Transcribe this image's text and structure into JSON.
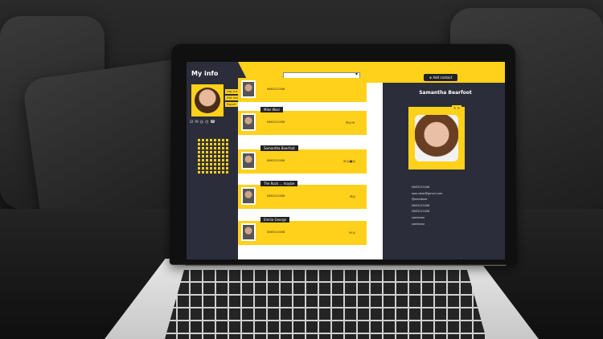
{
  "app": {
    "section_title": "My info",
    "search": {
      "placeholder": ""
    },
    "add_contact_label": "Add contact",
    "profile_buttons": [
      "Log out",
      "Edit info",
      "Export"
    ]
  },
  "contacts": [
    {
      "name": "",
      "phone": "0663123456"
    },
    {
      "name": "Mike Wazi",
      "phone": "0663123456"
    },
    {
      "name": "Samantha Bearfoot",
      "phone": "0663123456"
    },
    {
      "name": "The Rock ... maybe",
      "phone": "0663123456"
    },
    {
      "name": "Emilia George",
      "phone": "0663123456"
    }
  ],
  "detail": {
    "name": "Samantha Bearfoot",
    "fields": [
      "0663123456",
      "sam.bear@gmail.com",
      "@samibear",
      "0663123456",
      "0663123456",
      "samibear",
      "samibear"
    ]
  },
  "colors": {
    "accent": "#ffd11a",
    "panel": "#2b2d3a"
  }
}
